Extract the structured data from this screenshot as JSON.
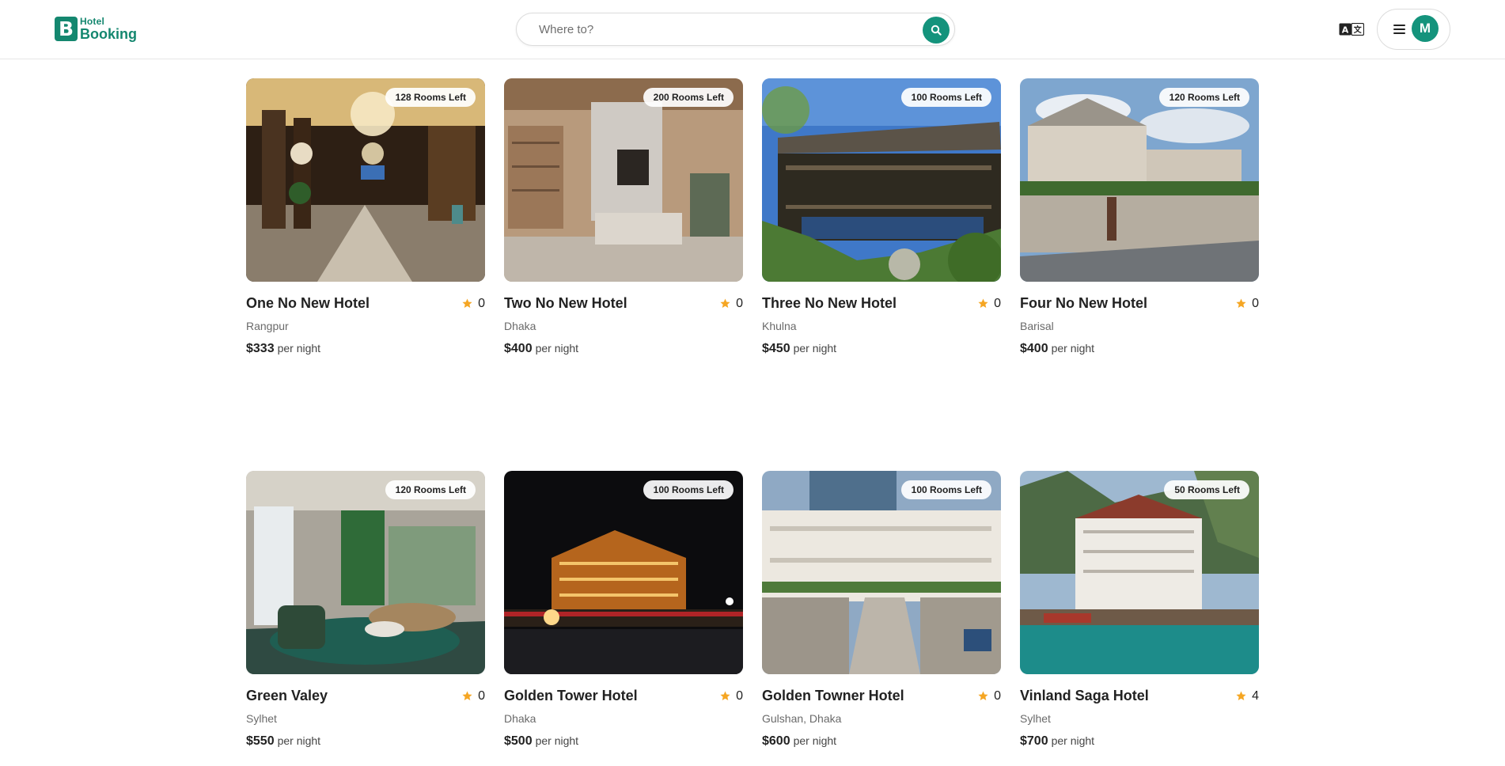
{
  "header": {
    "logo_mark": "B",
    "logo_line1": "Hotel",
    "logo_line2": "Booking",
    "search_placeholder": "Where to?",
    "avatar_initial": "M"
  },
  "colors": {
    "brand": "#14876f",
    "accent": "#14937c",
    "star": "#f5a623"
  },
  "icons": {
    "search": "search-icon",
    "language": "translate-icon",
    "menu": "menu-icon",
    "star": "star-icon"
  },
  "hotels": [
    {
      "name": "One No New Hotel",
      "location": "Rangpur",
      "price": "$333",
      "per_night": "per night",
      "rating": "0",
      "rooms_left": "128 Rooms Left"
    },
    {
      "name": "Two No New Hotel",
      "location": "Dhaka",
      "price": "$400",
      "per_night": "per night",
      "rating": "0",
      "rooms_left": "200 Rooms Left"
    },
    {
      "name": "Three No New Hotel",
      "location": "Khulna",
      "price": "$450",
      "per_night": "per night",
      "rating": "0",
      "rooms_left": "100 Rooms Left"
    },
    {
      "name": "Four No New Hotel",
      "location": "Barisal",
      "price": "$400",
      "per_night": "per night",
      "rating": "0",
      "rooms_left": "120 Rooms Left"
    },
    {
      "name": "Green Valey",
      "location": "Sylhet",
      "price": "$550",
      "per_night": "per night",
      "rating": "0",
      "rooms_left": "120 Rooms Left"
    },
    {
      "name": "Golden Tower Hotel",
      "location": "Dhaka",
      "price": "$500",
      "per_night": "per night",
      "rating": "0",
      "rooms_left": "100 Rooms Left"
    },
    {
      "name": "Golden Towner Hotel",
      "location": "Gulshan, Dhaka",
      "price": "$600",
      "per_night": "per night",
      "rating": "0",
      "rooms_left": "100 Rooms Left"
    },
    {
      "name": "Vinland Saga Hotel",
      "location": "Sylhet",
      "price": "$700",
      "per_night": "per night",
      "rating": "4",
      "rooms_left": "50 Rooms Left"
    }
  ]
}
